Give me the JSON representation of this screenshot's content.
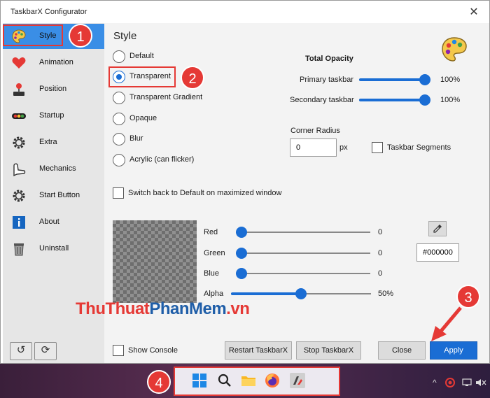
{
  "window": {
    "title": "TaskbarX Configurator",
    "close": "✕"
  },
  "sidebar": {
    "items": [
      {
        "label": "Style",
        "icon": "palette-icon"
      },
      {
        "label": "Animation",
        "icon": "heart-icon"
      },
      {
        "label": "Position",
        "icon": "joystick-icon"
      },
      {
        "label": "Startup",
        "icon": "traffic-light-icon"
      },
      {
        "label": "Extra",
        "icon": "gear-icon"
      },
      {
        "label": "Mechanics",
        "icon": "arm-icon"
      },
      {
        "label": "Start Button",
        "icon": "gear-icon"
      },
      {
        "label": "About",
        "icon": "info-icon"
      },
      {
        "label": "Uninstall",
        "icon": "trash-icon"
      }
    ],
    "reset_icon": "↺",
    "refresh_icon": "⟳"
  },
  "style": {
    "heading": "Style",
    "options": [
      "Default",
      "Transparent",
      "Transparent Gradient",
      "Opaque",
      "Blur",
      "Acrylic (can flicker)"
    ],
    "selected_index": 1,
    "switch_back_label": "Switch back to Default on maximized window"
  },
  "opacity": {
    "title": "Total Opacity",
    "primary_label": "Primary taskbar",
    "primary_value": "100%",
    "primary_level": 1.0,
    "secondary_label": "Secondary taskbar",
    "secondary_value": "100%",
    "secondary_level": 1.0
  },
  "corner": {
    "label": "Corner Radius",
    "value": "0",
    "unit": "px",
    "segments_label": "Taskbar Segments"
  },
  "color": {
    "red_label": "Red",
    "red_value": "0",
    "red_level": 0,
    "green_label": "Green",
    "green_value": "0",
    "green_level": 0,
    "blue_label": "Blue",
    "blue_value": "0",
    "blue_level": 0,
    "alpha_label": "Alpha",
    "alpha_value": "50%",
    "alpha_level": 0.5,
    "hex": "#000000"
  },
  "footer": {
    "show_console": "Show Console",
    "restart": "Restart TaskbarX",
    "stop": "Stop TaskbarX",
    "close": "Close",
    "apply": "Apply"
  },
  "annotations": [
    "1",
    "2",
    "3",
    "4"
  ],
  "watermark": {
    "part_a": "ThuThuat",
    "part_b": "PhanMem",
    "part_c": ".vn"
  },
  "colors": {
    "accent": "#1a6dd4",
    "highlight": "#e53935",
    "sidebar_active": "#3a8ee6"
  }
}
